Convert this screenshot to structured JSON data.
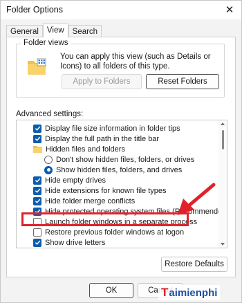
{
  "window": {
    "title": "Folder Options",
    "close_glyph": "✕"
  },
  "tabs": [
    {
      "label": "General",
      "active": false
    },
    {
      "label": "View",
      "active": true
    },
    {
      "label": "Search",
      "active": false
    }
  ],
  "folder_views": {
    "label": "Folder views",
    "description": "You can apply this view (such as Details or Icons) to all folders of this type.",
    "apply_button": "Apply to Folders",
    "reset_button": "Reset Folders",
    "icon": "folder-icon"
  },
  "advanced": {
    "label": "Advanced settings:",
    "items": [
      {
        "kind": "checkbox",
        "checked": true,
        "label": "Display file size information in folder tips"
      },
      {
        "kind": "checkbox",
        "checked": true,
        "label": "Display the full path in the title bar"
      },
      {
        "kind": "folder",
        "label": "Hidden files and folders"
      },
      {
        "kind": "radio",
        "checked": false,
        "label": "Don't show hidden files, folders, or drives"
      },
      {
        "kind": "radio",
        "checked": true,
        "label": "Show hidden files, folders, and drives"
      },
      {
        "kind": "checkbox",
        "checked": true,
        "label": "Hide empty drives"
      },
      {
        "kind": "checkbox",
        "checked": true,
        "label": "Hide extensions for known file types"
      },
      {
        "kind": "checkbox",
        "checked": true,
        "label": "Hide folder merge conflicts"
      },
      {
        "kind": "checkbox",
        "checked": true,
        "label": "Hide protected operating system files (Recommended)"
      },
      {
        "kind": "checkbox",
        "checked": false,
        "label": "Launch folder windows in a separate process"
      },
      {
        "kind": "checkbox",
        "checked": false,
        "label": "Restore previous folder windows at logon"
      },
      {
        "kind": "checkbox",
        "checked": true,
        "label": "Show drive letters"
      }
    ],
    "restore_button": "Restore Defaults"
  },
  "footer": {
    "ok_button": "OK",
    "cancel_button": "Cancel"
  },
  "colors": {
    "accent": "#0b5cad",
    "annotation": "#e0212b"
  },
  "watermark": {
    "lead": "T",
    "rest": "aimienphi"
  }
}
